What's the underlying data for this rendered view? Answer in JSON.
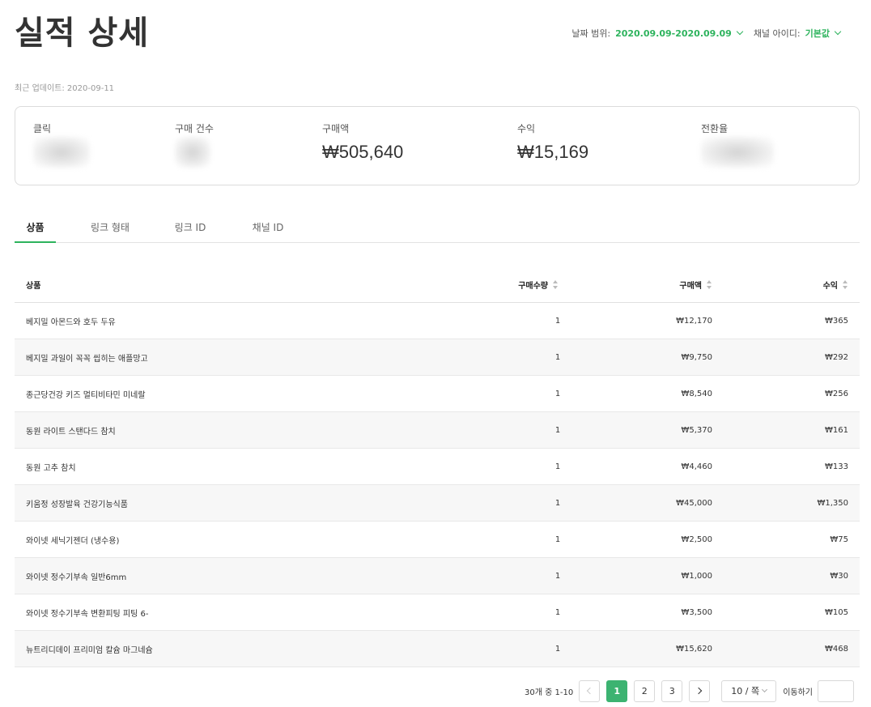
{
  "header": {
    "title": "실적 상세",
    "date_range_label": "날짜 범위:",
    "date_range_value": "2020.09.09-2020.09.09",
    "channel_label": "채널 아이디:",
    "channel_value": "기본값"
  },
  "updated": "최근 업데이트: 2020-09-11",
  "summary": {
    "clicks_label": "클릭",
    "orders_label": "구매 건수",
    "amount_label": "구매액",
    "amount_value": "₩505,640",
    "revenue_label": "수익",
    "revenue_value": "₩15,169",
    "conversion_label": "전환율"
  },
  "tabs": [
    {
      "label": "상품",
      "active": true
    },
    {
      "label": "링크 형태",
      "active": false
    },
    {
      "label": "링크 ID",
      "active": false
    },
    {
      "label": "채널 ID",
      "active": false
    }
  ],
  "table": {
    "headers": {
      "product": "상품",
      "quantity": "구매수량",
      "amount": "구매액",
      "revenue": "수익"
    },
    "rows": [
      {
        "product": "베지밀 아몬드와 호두 두유",
        "quantity": "1",
        "amount": "₩12,170",
        "revenue": "₩365"
      },
      {
        "product": "베지밀 과일이 꼭꼭 씹히는 애플망고",
        "quantity": "1",
        "amount": "₩9,750",
        "revenue": "₩292"
      },
      {
        "product": "종근당건강 키즈 멀티비타민 미네랄",
        "quantity": "1",
        "amount": "₩8,540",
        "revenue": "₩256"
      },
      {
        "product": "동원 라이트 스탠다드 참치",
        "quantity": "1",
        "amount": "₩5,370",
        "revenue": "₩161"
      },
      {
        "product": "동원 고추 참치",
        "quantity": "1",
        "amount": "₩4,460",
        "revenue": "₩133"
      },
      {
        "product": "키움정 성장발육 건강기능식품",
        "quantity": "1",
        "amount": "₩45,000",
        "revenue": "₩1,350"
      },
      {
        "product": "와이넷 세닉기젠더 (냉수용)",
        "quantity": "1",
        "amount": "₩2,500",
        "revenue": "₩75"
      },
      {
        "product": "와이넷 정수기부속 일반6mm",
        "quantity": "1",
        "amount": "₩1,000",
        "revenue": "₩30"
      },
      {
        "product": "와이넷 정수기부속 변환피팅 피팅 6-",
        "quantity": "1",
        "amount": "₩3,500",
        "revenue": "₩105"
      },
      {
        "product": "뉴트리디데이 프리미엄 칼슘 마그네슘",
        "quantity": "1",
        "amount": "₩15,620",
        "revenue": "₩468"
      }
    ]
  },
  "pagination": {
    "total_text": "30개 중 1-10",
    "pages": [
      "1",
      "2",
      "3"
    ],
    "current_page": "1",
    "page_size": "10 / 쪽",
    "goto_label": "이동하기"
  },
  "colors": {
    "accent": "#2db35d",
    "active_page": "#3cb371"
  }
}
